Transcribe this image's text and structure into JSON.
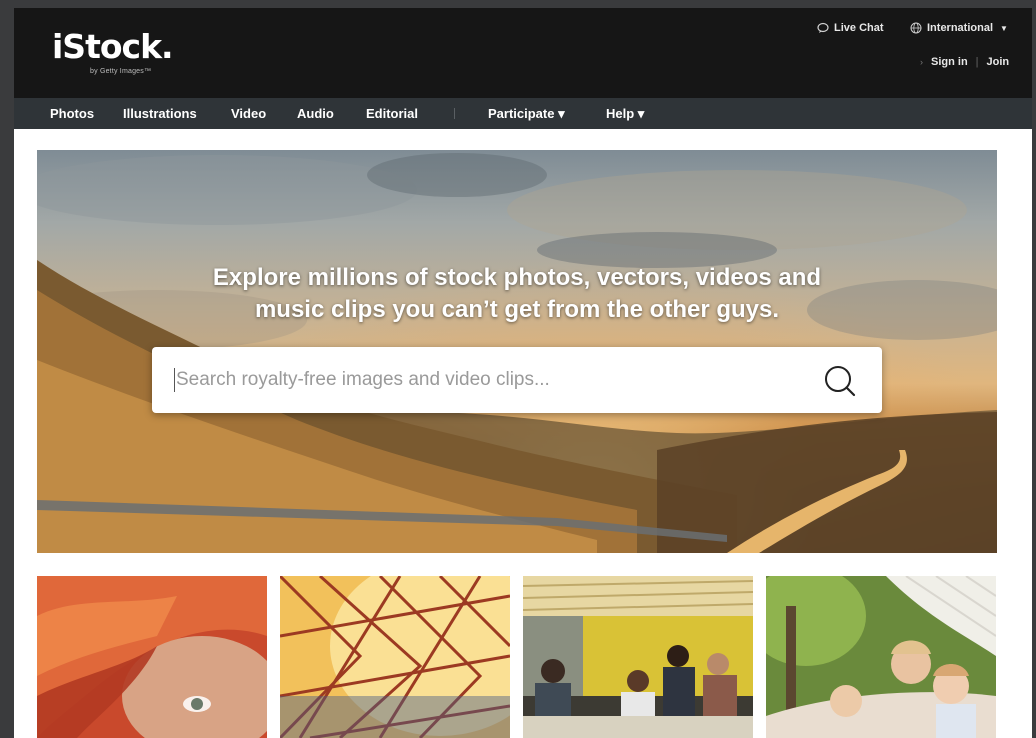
{
  "header": {
    "logo_text": "iStock.",
    "logo_sub": "by Getty Images™",
    "live_chat": "Live Chat",
    "region": "International",
    "sign_in": "Sign in",
    "separator": "|",
    "join": "Join"
  },
  "nav": {
    "items": [
      {
        "label": "Photos"
      },
      {
        "label": "Illustrations"
      },
      {
        "label": "Video"
      },
      {
        "label": "Audio"
      },
      {
        "label": "Editorial"
      },
      {
        "label": "Participate ▾"
      },
      {
        "label": "Help ▾"
      }
    ]
  },
  "hero": {
    "headline_line1": "Explore millions of stock photos, vectors, videos and",
    "headline_line2": "music clips you can’t get from the other guys.",
    "search_placeholder": "Search royalty-free images and video clips..."
  },
  "icons": {
    "live_chat": "chat-bubble-icon",
    "region": "globe-icon",
    "search": "magnifier-icon",
    "dropdown": "caret-down-icon"
  },
  "colors": {
    "topbar": "#161616",
    "navbar": "#2f3438",
    "page_bg": "#3a3b3d"
  }
}
